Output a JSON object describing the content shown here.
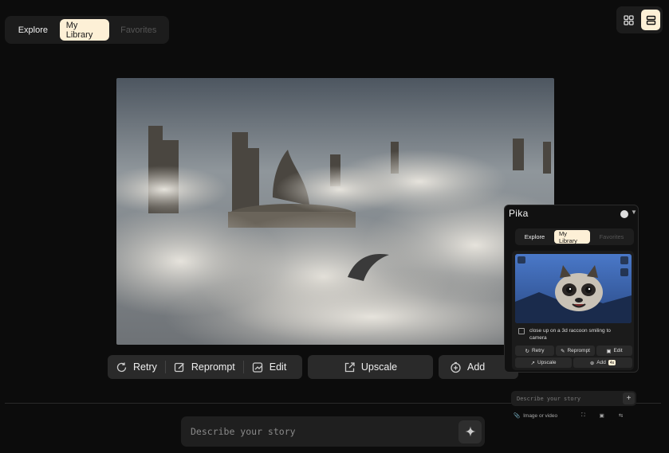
{
  "tabs": [
    {
      "label": "Explore",
      "state": "normal"
    },
    {
      "label": "My Library",
      "state": "active"
    },
    {
      "label": "Favorites",
      "state": "disabled"
    }
  ],
  "view_toggle": {
    "grid_icon": "grid-icon",
    "list_icon": "list-icon",
    "active": "list"
  },
  "hero": {
    "icon": "image-futuristic-city-in-clouds"
  },
  "actions": {
    "retry": "Retry",
    "reprompt": "Reprompt",
    "edit": "Edit",
    "upscale": "Upscale",
    "add": "Add"
  },
  "prompt": {
    "placeholder": "Describe your story",
    "icon": "sparkle-icon"
  },
  "popup": {
    "logo": "Pika",
    "tabs": [
      {
        "label": "Explore",
        "state": "normal"
      },
      {
        "label": "My Library",
        "state": "active"
      },
      {
        "label": "Favorites",
        "state": "disabled"
      }
    ],
    "caption": "close up on a 3d raccoon smiling to camera",
    "actions": {
      "retry": "Retry",
      "reprompt": "Reprompt",
      "edit": "Edit",
      "upscale": "Upscale",
      "add": "Add",
      "badge": "4s"
    },
    "prompt_placeholder": "Describe your story",
    "tools": {
      "attach": "Image or video"
    }
  },
  "colors": {
    "accent": "#fdf0d6",
    "bg": "#0c0c0c",
    "panel": "#1c1c1c"
  }
}
